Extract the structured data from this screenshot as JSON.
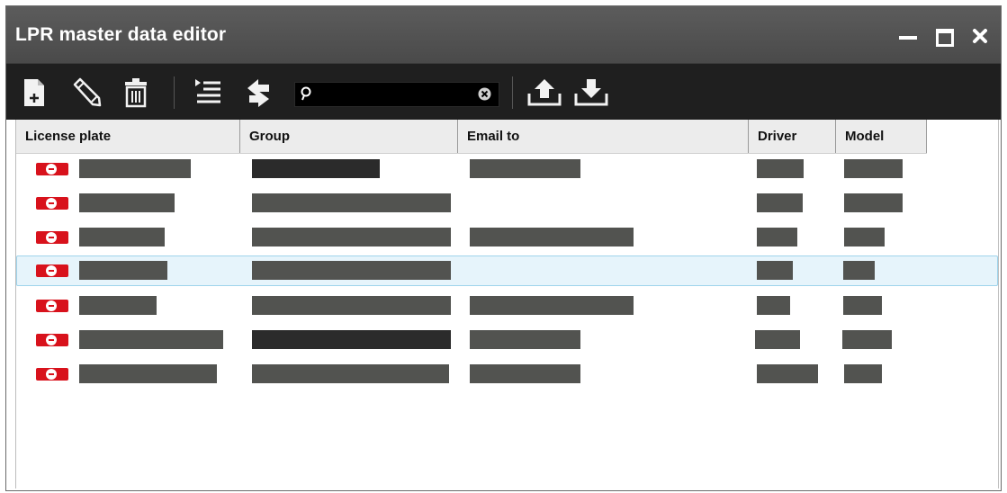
{
  "window": {
    "title": "LPR master data editor",
    "controls": [
      "minimize-icon",
      "maximize-icon",
      "close-icon"
    ]
  },
  "toolbar": {
    "icons": [
      "new-record-icon",
      "edit-pencil-icon",
      "delete-trash-icon",
      "list-view-icon",
      "sync-arrows-icon",
      "upload-icon",
      "download-icon"
    ],
    "search": {
      "value": "",
      "placeholder": ""
    }
  },
  "table": {
    "columns": [
      "License plate",
      "Group",
      "Email to",
      "Driver",
      "Model"
    ],
    "selected_row": 3,
    "rows_note_redacted": true
  },
  "colors": {
    "titlebar": "#4f4f4f",
    "toolbar": "#1f1f1f",
    "selection": "#e6f4fb",
    "plate_icon": "#d8121c",
    "redaction": "#525350"
  }
}
